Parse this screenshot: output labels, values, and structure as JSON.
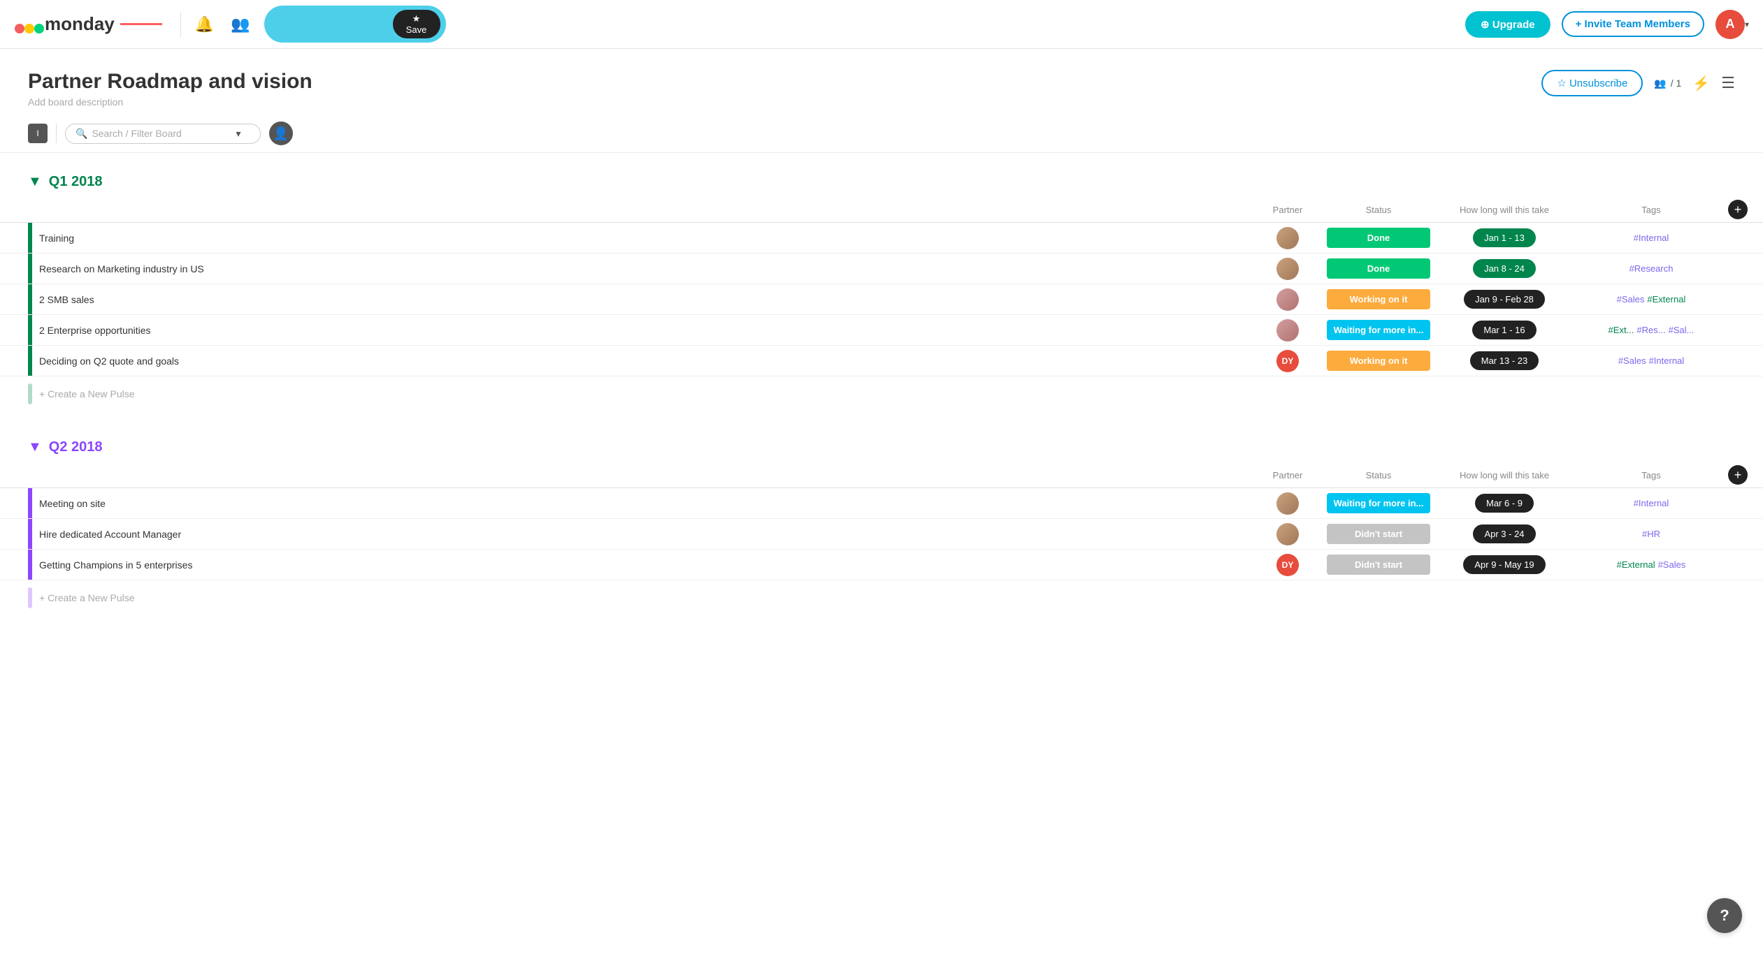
{
  "header": {
    "logo_text": "monday",
    "save_label": "★ Save",
    "upgrade_label": "⊕ Upgrade",
    "invite_label": "+ Invite Team Members",
    "avatar_letter": "A",
    "search_placeholder": ""
  },
  "board": {
    "title": "Partner Roadmap and vision",
    "description": "Add board description",
    "unsubscribe_label": "☆ Unsubscribe",
    "subscribers": "/ 1"
  },
  "toolbar": {
    "filter_toggle": "I",
    "search_placeholder": "Search / Filter Board"
  },
  "groups": [
    {
      "id": "q1",
      "title": "Q1 2018",
      "color": "#00854d",
      "columns": {
        "partner": "Partner",
        "status": "Status",
        "timeline": "How long will this take",
        "tags": "Tags"
      },
      "tasks": [
        {
          "name": "Training",
          "partner_color": "#c9a27e",
          "partner_initials": "",
          "status": "Done",
          "status_class": "status-done",
          "timeline": "Jan 1 - 13",
          "timeline_class": "timeline-badge-green",
          "tags": [
            "#Internal"
          ],
          "tag_classes": [
            "tag-purple"
          ]
        },
        {
          "name": "Research on Marketing industry in US",
          "partner_color": "#c9a27e",
          "partner_initials": "",
          "status": "Done",
          "status_class": "status-done",
          "timeline": "Jan 8 - 24",
          "timeline_class": "timeline-badge-green",
          "tags": [
            "#Research"
          ],
          "tag_classes": [
            "tag-purple"
          ]
        },
        {
          "name": "2 SMB sales",
          "partner_color": "#d4a0a0",
          "partner_initials": "",
          "status": "Working on it",
          "status_class": "status-working",
          "timeline": "Jan 9 - Feb 28",
          "timeline_class": "",
          "tags": [
            "#Sales",
            "#External"
          ],
          "tag_classes": [
            "tag-purple",
            "tag-green"
          ]
        },
        {
          "name": "2 Enterprise opportunities",
          "partner_color": "#d4a0a0",
          "partner_initials": "",
          "status": "Waiting for more in...",
          "status_class": "status-waiting",
          "timeline": "Mar 1 - 16",
          "timeline_class": "",
          "tags": [
            "#Ext...",
            "#Res...",
            "#Sal..."
          ],
          "tag_classes": [
            "tag-green",
            "tag-purple",
            "tag-purple"
          ]
        },
        {
          "name": "Deciding on Q2 quote and goals",
          "partner_color": "#e74c3c",
          "partner_initials": "DY",
          "status": "Working on it",
          "status_class": "status-working",
          "timeline": "Mar 13 - 23",
          "timeline_class": "",
          "tags": [
            "#Sales",
            "#Internal"
          ],
          "tag_classes": [
            "tag-purple",
            "tag-purple"
          ]
        }
      ],
      "create_pulse": "+ Create a New Pulse"
    },
    {
      "id": "q2",
      "title": "Q2 2018",
      "color": "#8b46ff",
      "columns": {
        "partner": "Partner",
        "status": "Status",
        "timeline": "How long will this take",
        "tags": "Tags"
      },
      "tasks": [
        {
          "name": "Meeting on site",
          "partner_color": "#c9a27e",
          "partner_initials": "",
          "status": "Waiting for more in...",
          "status_class": "status-waiting",
          "timeline": "Mar 6 - 9",
          "timeline_class": "",
          "tags": [
            "#Internal"
          ],
          "tag_classes": [
            "tag-purple"
          ]
        },
        {
          "name": "Hire dedicated Account Manager",
          "partner_color": "#c9a27e",
          "partner_initials": "",
          "status": "Didn't start",
          "status_class": "status-didnt",
          "timeline": "Apr 3 - 24",
          "timeline_class": "",
          "tags": [
            "#HR"
          ],
          "tag_classes": [
            "tag-purple"
          ]
        },
        {
          "name": "Getting Champions in 5 enterprises",
          "partner_color": "#e74c3c",
          "partner_initials": "DY",
          "status": "Didn't start",
          "status_class": "status-didnt",
          "timeline": "Apr 9 - May 19",
          "timeline_class": "",
          "tags": [
            "#External",
            "#Sales"
          ],
          "tag_classes": [
            "tag-green",
            "tag-purple"
          ]
        }
      ],
      "create_pulse": "+ Create a New Pulse"
    }
  ],
  "help_label": "?"
}
